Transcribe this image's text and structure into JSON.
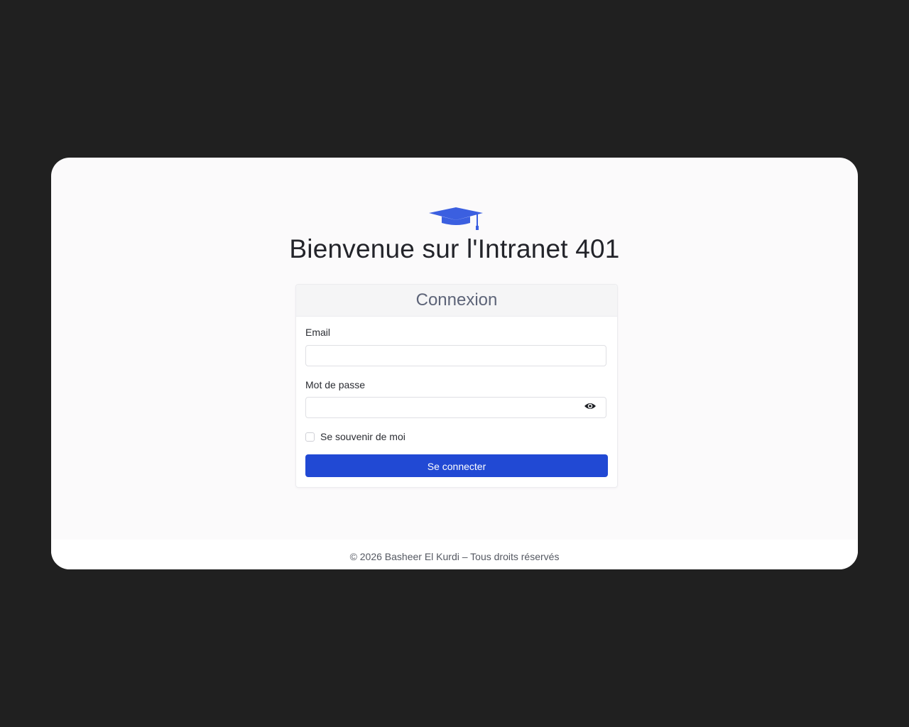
{
  "branding": {
    "logo_icon": "graduation-cap-icon",
    "welcome_title": "Bienvenue sur l'Intranet 401"
  },
  "login_card": {
    "title": "Connexion",
    "email_label": "Email",
    "email_value": "",
    "password_label": "Mot de passe",
    "password_value": "",
    "toggle_icon": "eye-icon",
    "remember_label": "Se souvenir de moi",
    "remember_checked": false,
    "submit_label": "Se connecter"
  },
  "footer": {
    "copyright": "© 2026 Basheer El Kurdi – Tous droits réservés"
  },
  "colors": {
    "accent": "#2149d4",
    "logo": "#3b5fe0",
    "background": "#202020",
    "panel": "#fbfafb"
  }
}
